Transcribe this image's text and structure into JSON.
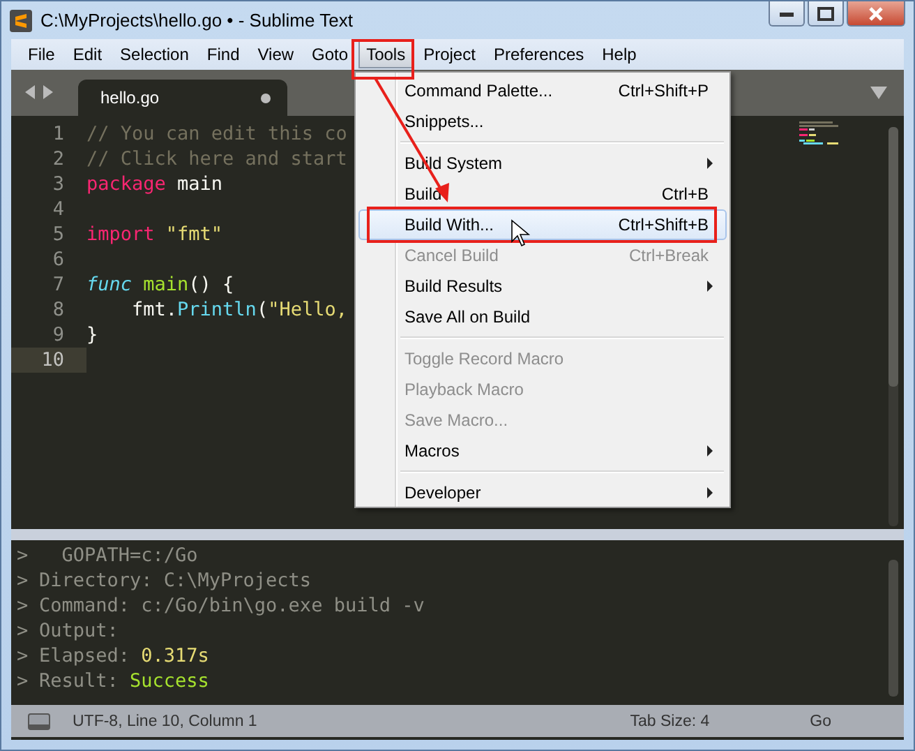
{
  "window": {
    "title": "C:\\MyProjects\\hello.go • - Sublime Text"
  },
  "menubar": [
    {
      "label": "File",
      "selected": false
    },
    {
      "label": "Edit",
      "selected": false
    },
    {
      "label": "Selection",
      "selected": false
    },
    {
      "label": "Find",
      "selected": false
    },
    {
      "label": "View",
      "selected": false
    },
    {
      "label": "Goto",
      "selected": false
    },
    {
      "label": "Tools",
      "selected": true
    },
    {
      "label": "Project",
      "selected": false
    },
    {
      "label": "Preferences",
      "selected": false
    },
    {
      "label": "Help",
      "selected": false
    }
  ],
  "tabs": [
    {
      "label": "hello.go",
      "selected": true,
      "modified": true
    }
  ],
  "editor": {
    "lines": [
      {
        "number": "1",
        "current": false,
        "tokens": [
          {
            "kind": "comment",
            "text": "// You can edit this co"
          }
        ]
      },
      {
        "number": "2",
        "current": false,
        "tokens": [
          {
            "kind": "comment",
            "text": "// Click here and start"
          }
        ]
      },
      {
        "number": "3",
        "current": false,
        "tokens": [
          {
            "kind": "keyword",
            "text": "package"
          },
          {
            "kind": "plain",
            "text": " main"
          }
        ]
      },
      {
        "number": "4",
        "current": false
      },
      {
        "number": "5",
        "current": false,
        "tokens": [
          {
            "kind": "keyword",
            "text": "import"
          },
          {
            "kind": "string",
            "text": " \"fmt\""
          }
        ]
      },
      {
        "number": "6",
        "current": false
      },
      {
        "number": "7",
        "current": false,
        "tokens": [
          {
            "kind": "storage",
            "text": "func"
          },
          {
            "kind": "function",
            "text": " main"
          },
          {
            "kind": "plain",
            "text": "() {"
          }
        ]
      },
      {
        "number": "8",
        "current": false,
        "tokens": [
          {
            "kind": "plain",
            "text": "    fmt."
          },
          {
            "kind": "builtin",
            "text": "Println"
          },
          {
            "kind": "plain",
            "text": "("
          },
          {
            "kind": "string",
            "text": "\"Hello,"
          }
        ]
      },
      {
        "number": "9",
        "current": false,
        "tokens": [
          {
            "kind": "plain",
            "text": "}"
          }
        ]
      },
      {
        "number": "10",
        "current": true
      }
    ]
  },
  "tools_menu": [
    {
      "kind": "item",
      "label": "Command Palette...",
      "shortcut": "Ctrl+Shift+P",
      "disabled": false,
      "selected": false,
      "submenu": false
    },
    {
      "kind": "item",
      "label": "Snippets...",
      "disabled": false,
      "selected": false,
      "submenu": false
    },
    {
      "kind": "separator"
    },
    {
      "kind": "item",
      "label": "Build System",
      "disabled": false,
      "selected": false,
      "submenu": true
    },
    {
      "kind": "item",
      "label": "Build",
      "shortcut": "Ctrl+B",
      "disabled": false,
      "selected": false,
      "submenu": false
    },
    {
      "kind": "item",
      "label": "Build With...",
      "shortcut": "Ctrl+Shift+B",
      "disabled": false,
      "selected": true,
      "submenu": false
    },
    {
      "kind": "item",
      "label": "Cancel Build",
      "shortcut": "Ctrl+Break",
      "disabled": true,
      "selected": false,
      "submenu": false
    },
    {
      "kind": "item",
      "label": "Build Results",
      "disabled": false,
      "selected": false,
      "submenu": true
    },
    {
      "kind": "item",
      "label": "Save All on Build",
      "disabled": false,
      "selected": false,
      "submenu": false
    },
    {
      "kind": "separator"
    },
    {
      "kind": "item",
      "label": "Toggle Record Macro",
      "disabled": true,
      "selected": false,
      "submenu": false
    },
    {
      "kind": "item",
      "label": "Playback Macro",
      "disabled": true,
      "selected": false,
      "submenu": false
    },
    {
      "kind": "item",
      "label": "Save Macro...",
      "disabled": true,
      "selected": false,
      "submenu": false
    },
    {
      "kind": "item",
      "label": "Macros",
      "disabled": false,
      "selected": false,
      "submenu": true
    },
    {
      "kind": "separator"
    },
    {
      "kind": "item",
      "label": "Developer",
      "disabled": false,
      "selected": false,
      "submenu": true
    }
  ],
  "output_panel": {
    "lines": [
      {
        "prompt": ">",
        "segments": [
          {
            "kind": "plain",
            "text": "  GOPATH=c:/Go"
          }
        ]
      },
      {
        "prompt": ">",
        "segments": [
          {
            "kind": "plain",
            "text": "Directory: C:\\MyProjects"
          }
        ]
      },
      {
        "prompt": ">",
        "segments": [
          {
            "kind": "plain",
            "text": "Command: c:/Go/bin\\go.exe build -v"
          }
        ]
      },
      {
        "prompt": ">",
        "segments": [
          {
            "kind": "plain",
            "text": "Output:"
          }
        ]
      },
      {
        "prompt": ">",
        "segments": [
          {
            "kind": "plain",
            "text": "Elapsed: "
          },
          {
            "kind": "number",
            "text": "0.317s"
          }
        ]
      },
      {
        "prompt": ">",
        "segments": [
          {
            "kind": "plain",
            "text": "Result: "
          },
          {
            "kind": "success",
            "text": "Success"
          }
        ]
      }
    ]
  },
  "status_bar": {
    "position": "UTF-8, Line 10, Column 1",
    "tab_size": "Tab Size: 4",
    "syntax": "Go"
  }
}
